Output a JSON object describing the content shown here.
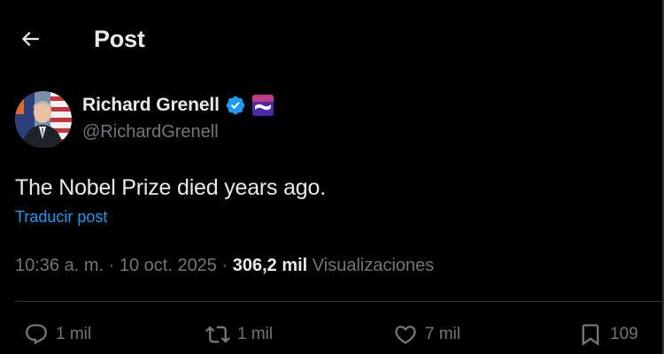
{
  "header": {
    "title": "Post",
    "back_icon": "arrow-left-icon"
  },
  "author": {
    "name": "Richard Grenell",
    "handle": "@RichardGrenell",
    "verified_icon": "verified-badge-icon",
    "affiliate_icon": "affiliate-badge-icon"
  },
  "post": {
    "text": "The Nobel Prize died years ago.",
    "translate_label": "Traducir post"
  },
  "meta": {
    "time": "10:36 a. m.",
    "separator": " · ",
    "date": "10 oct. 2025",
    "views_count": "306,2 mil",
    "views_label": " Visualizaciones"
  },
  "actions": {
    "reply": {
      "icon": "reply-icon",
      "count": "1 mil"
    },
    "repost": {
      "icon": "repost-icon",
      "count": "1 mil"
    },
    "like": {
      "icon": "heart-icon",
      "count": "7 mil"
    },
    "bookmark": {
      "icon": "bookmark-icon",
      "count": "109"
    }
  },
  "colors": {
    "background": "#000000",
    "text_primary": "#e7e9ea",
    "text_secondary": "#71767b",
    "link": "#1d9bf0",
    "verified": "#1d9bf0",
    "divider": "#2f3336"
  }
}
